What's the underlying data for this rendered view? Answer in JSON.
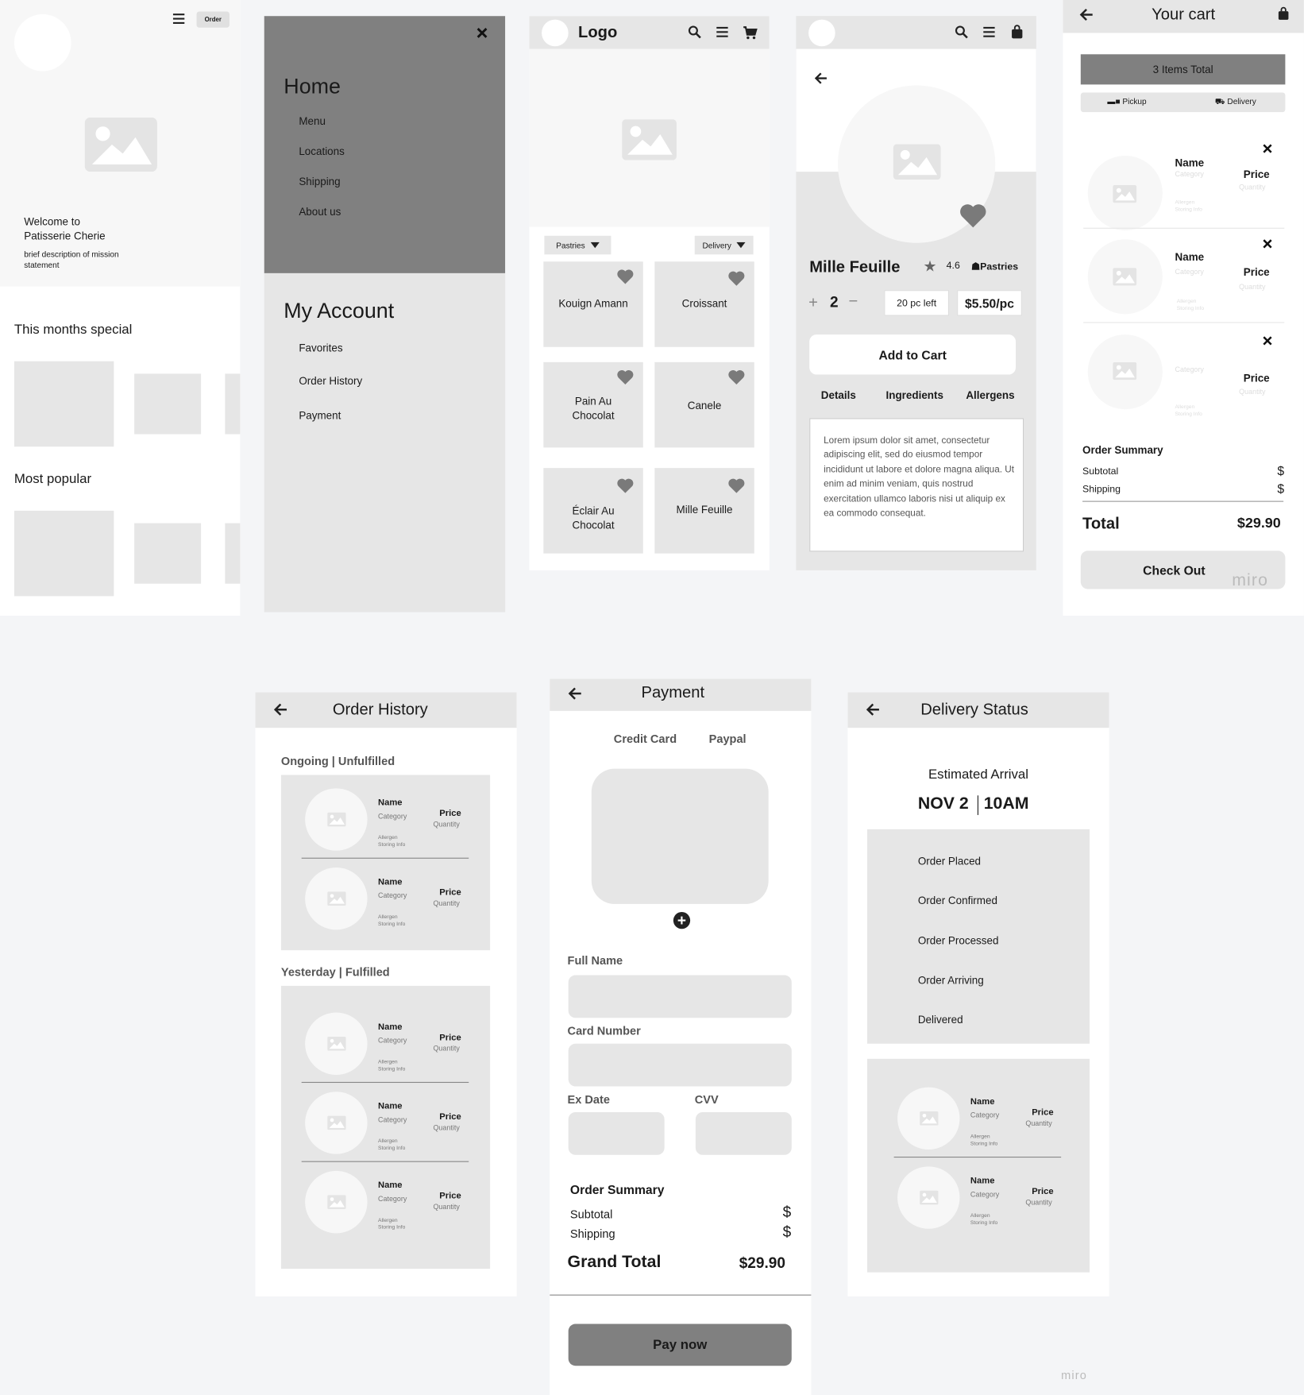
{
  "home": {
    "order_button": "Order",
    "welcome": "Welcome to",
    "brand": "Patisserie Cherie",
    "mission": "brief description of mission statement",
    "special_title": "This months special",
    "popular_title": "Most popular"
  },
  "menu": {
    "home": "Home",
    "items": [
      "Menu",
      "Locations",
      "Shipping",
      "About us"
    ],
    "account": "My Account",
    "account_items": [
      "Favorites",
      "Order History",
      "Payment"
    ]
  },
  "shop": {
    "logo": "Logo",
    "filter_category": "Pastries",
    "filter_mode": "Delivery",
    "products": [
      "Kouign Amann",
      "Croissant",
      "Pain Au Chocolat",
      "Canele",
      "Éclair Au Chocolat",
      "Mille Feuille"
    ]
  },
  "detail": {
    "name": "Mille Feuille",
    "rating": "4.6",
    "category": "Pastries",
    "quantity": "2",
    "stock": "20 pc left",
    "price": "$5.50/pc",
    "add_to_cart": "Add to Cart",
    "tabs": [
      "Details",
      "Ingredients",
      "Allergens"
    ],
    "description": "Lorem ipsum dolor sit amet, consectetur adipiscing elit, sed do eiusmod tempor incididunt ut labore et dolore magna aliqua. Ut enim ad minim veniam, quis nostrud exercitation ullamco laboris nisi ut aliquip ex ea commodo consequat."
  },
  "item": {
    "name": "Name",
    "category": "Category",
    "price": "Price",
    "quantity": "Quantity",
    "allergen": "Allergen",
    "storing": "Storing Info"
  },
  "cart": {
    "title": "Your cart",
    "items_total": "3 Items Total",
    "pickup": "Pickup",
    "delivery": "Delivery",
    "summary_title": "Order Summary",
    "subtotal": "Subtotal",
    "subtotal_value": "$",
    "shipping": "Shipping",
    "shipping_value": "$",
    "total": "Total",
    "total_value": "$29.90",
    "checkout": "Check Out",
    "watermark": "miro"
  },
  "history": {
    "title": "Order History",
    "ongoing": "Ongoing | Unfulfilled",
    "yesterday": "Yesterday | Fulfilled"
  },
  "payment": {
    "title": "Payment",
    "tabs": [
      "Credit Card",
      "Paypal"
    ],
    "full_name": "Full Name",
    "card_number": "Card Number",
    "ex_date": "Ex Date",
    "cvv": "CVV",
    "summary_title": "Order Summary",
    "subtotal": "Subtotal",
    "subtotal_value": "$",
    "shipping": "Shipping",
    "shipping_value": "$",
    "grand_total": "Grand Total",
    "grand_total_value": "$29.90",
    "pay_now": "Pay now"
  },
  "delivery": {
    "title": "Delivery Status",
    "eta_label": "Estimated Arrival",
    "eta_date": "NOV 2",
    "eta_time": "10AM",
    "steps": [
      "Order Placed",
      "Order Confirmed",
      "Order Processed",
      "Order Arriving",
      "Delivered"
    ]
  },
  "watermark": "miro",
  "colors": {
    "dark_gray": "#808080",
    "light_gray": "#e6e6e6",
    "placeholder": "#f7f7f7"
  }
}
